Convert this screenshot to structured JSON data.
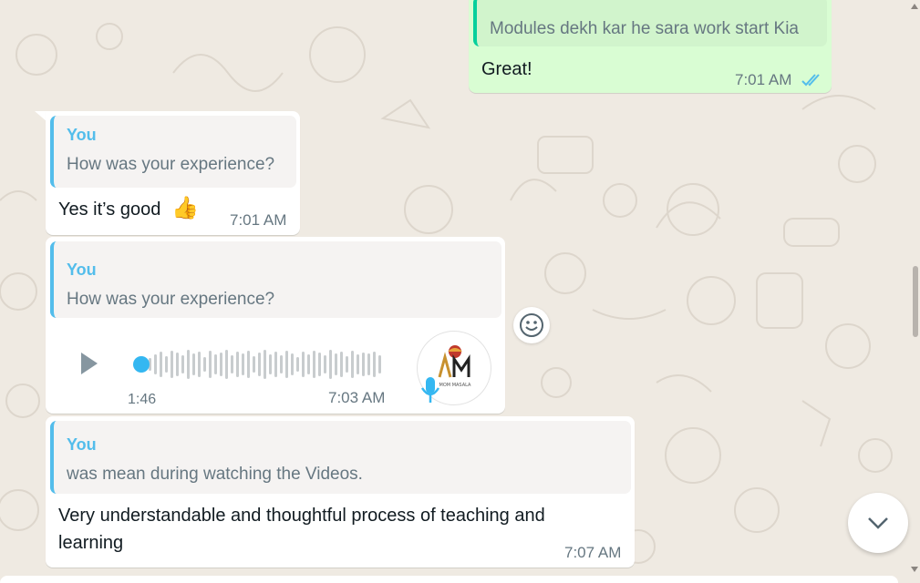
{
  "messages": [
    {
      "direction": "outgoing",
      "quote_text": "Modules dekh kar he sara work start Kia",
      "text": "Great!",
      "time": "7:01 AM",
      "status": "read"
    },
    {
      "direction": "incoming",
      "quote_author": "You",
      "quote_text": "How was your experience?",
      "text": "Yes it’s good",
      "emoji": "👍",
      "time": "7:01 AM"
    },
    {
      "direction": "incoming",
      "type": "voice",
      "quote_author": "You",
      "quote_text": "How was your experience?",
      "duration": "1:46",
      "time": "7:03 AM",
      "progress": 0.0,
      "avatar_text": "MOM MASALA"
    },
    {
      "direction": "incoming",
      "quote_author": "You",
      "quote_text": "was mean during watching the Videos.",
      "text": "Very understandable and thoughtful process of teaching and learning",
      "time": "7:07 AM"
    }
  ],
  "icons": {
    "play": "play-icon",
    "mic": "mic-icon",
    "emoji": "smiley-icon",
    "scroll_down": "chevron-down-icon",
    "read_ticks": "double-check-icon"
  },
  "colors": {
    "background": "#efeae2",
    "incoming_bubble": "#ffffff",
    "outgoing_bubble": "#d9fdd3",
    "quote_accent": "#53bdeb",
    "tick_blue": "#53bdeb",
    "voice_accent": "#34b7f1"
  }
}
